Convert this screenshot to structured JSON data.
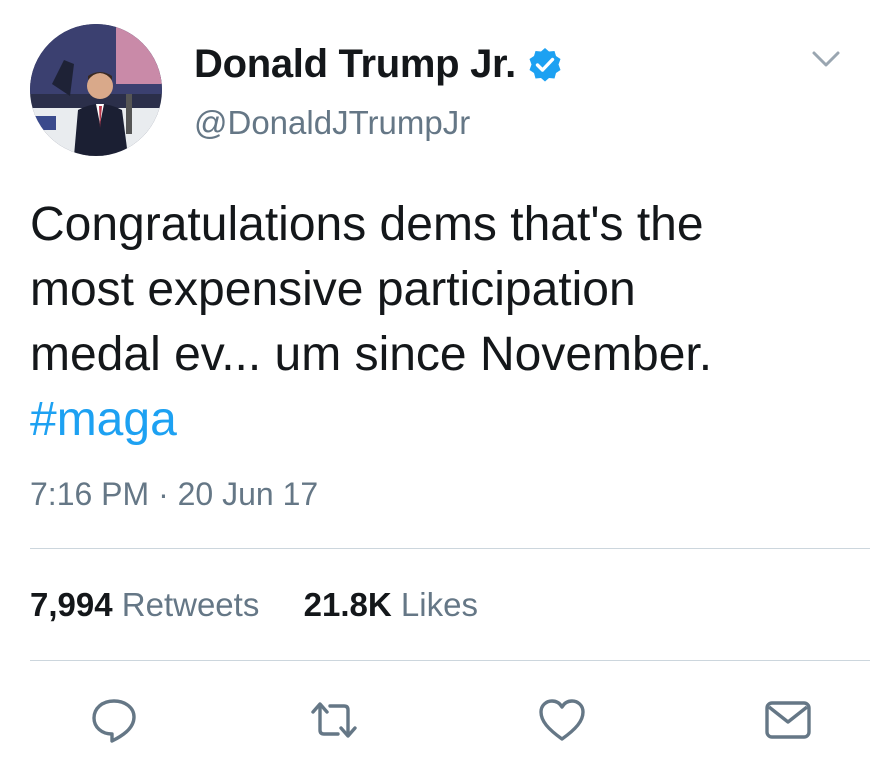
{
  "author": {
    "display_name": "Donald Trump Jr.",
    "handle": "@DonaldJTrumpJr",
    "verified": true
  },
  "tweet": {
    "text_lines": [
      "Congratulations dems that's the",
      "most expensive participation",
      "medal ev... um since November."
    ],
    "hashtag": "#maga",
    "timestamp": "7:16 PM · 20 Jun 17"
  },
  "stats": {
    "retweets_count": "7,994",
    "retweets_label": "Retweets",
    "likes_count": "21.8K",
    "likes_label": "Likes"
  },
  "actions": [
    {
      "icon": "reply-icon"
    },
    {
      "icon": "retweet-icon"
    },
    {
      "icon": "like-icon"
    },
    {
      "icon": "direct-message-icon"
    }
  ],
  "colors": {
    "text": "#14171a",
    "secondary_text": "#657786",
    "link": "#1da1f2",
    "verified_badge": "#1da1f2",
    "divider": "#ccd6dd",
    "action_icons": "#657786"
  }
}
